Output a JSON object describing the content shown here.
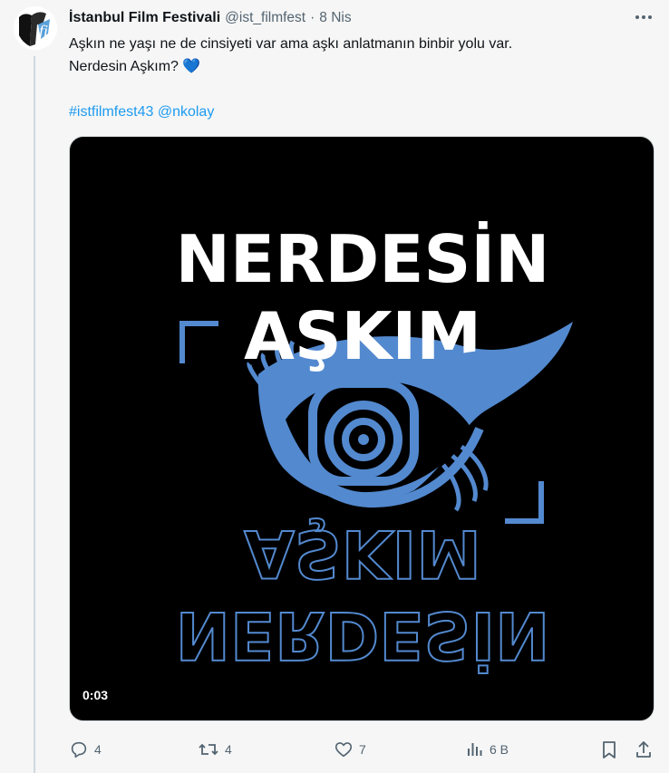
{
  "tweet": {
    "author_name": "İstanbul Film Festivali",
    "author_handle": "@ist_filmfest",
    "separator": "·",
    "date": "8 Nis",
    "text_line1": "Aşkın ne yaşı ne de cinsiyeti var ama aşkı anlatmanın binbir yolu var.",
    "text_line2": "Nerdesin Aşkım?",
    "emoji": "💙",
    "hashtag": "#istfilmfest43",
    "mention": "@nkolay"
  },
  "media": {
    "title_line1": "NERDESİN",
    "title_line2": "AŞKIM",
    "mirror_line1": "AŞKIM",
    "mirror_line2": "NERDESİN",
    "timecode": "0:03",
    "eye_color": "#5389cf"
  },
  "actions": {
    "replies": "4",
    "retweets": "4",
    "likes": "7",
    "views": "6 B"
  },
  "icons": [
    "avatar-logo",
    "more-icon",
    "reply-icon",
    "retweet-icon",
    "like-icon",
    "views-icon",
    "bookmark-icon",
    "share-icon"
  ]
}
